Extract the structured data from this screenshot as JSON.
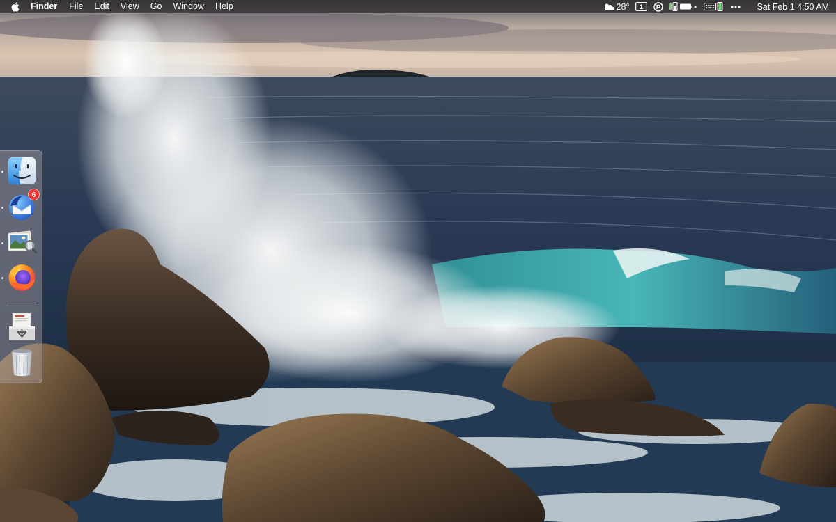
{
  "menubar": {
    "app_name": "Finder",
    "items": [
      "File",
      "Edit",
      "View",
      "Go",
      "Window",
      "Help"
    ],
    "weather_temp": "28°",
    "keyboard_indicator": "1",
    "clock": "Sat Feb 1  4:50 AM"
  },
  "dock": {
    "items": [
      {
        "name": "Finder",
        "icon": "finder-icon",
        "running": true
      },
      {
        "name": "Thunderbird",
        "icon": "thunderbird-icon",
        "running": true,
        "badge": "6"
      },
      {
        "name": "Preview",
        "icon": "preview-icon",
        "running": true
      },
      {
        "name": "Firefox",
        "icon": "firefox-icon",
        "running": true
      },
      {
        "name": "Downloads",
        "icon": "downloads-stack-icon",
        "running": false
      },
      {
        "name": "Trash",
        "icon": "trash-icon",
        "running": false
      }
    ]
  },
  "colors": {
    "menubar_bg": "#282626",
    "badge": "#e8322d",
    "sea": "#2a3a52",
    "wave": "#3aa3a6"
  }
}
